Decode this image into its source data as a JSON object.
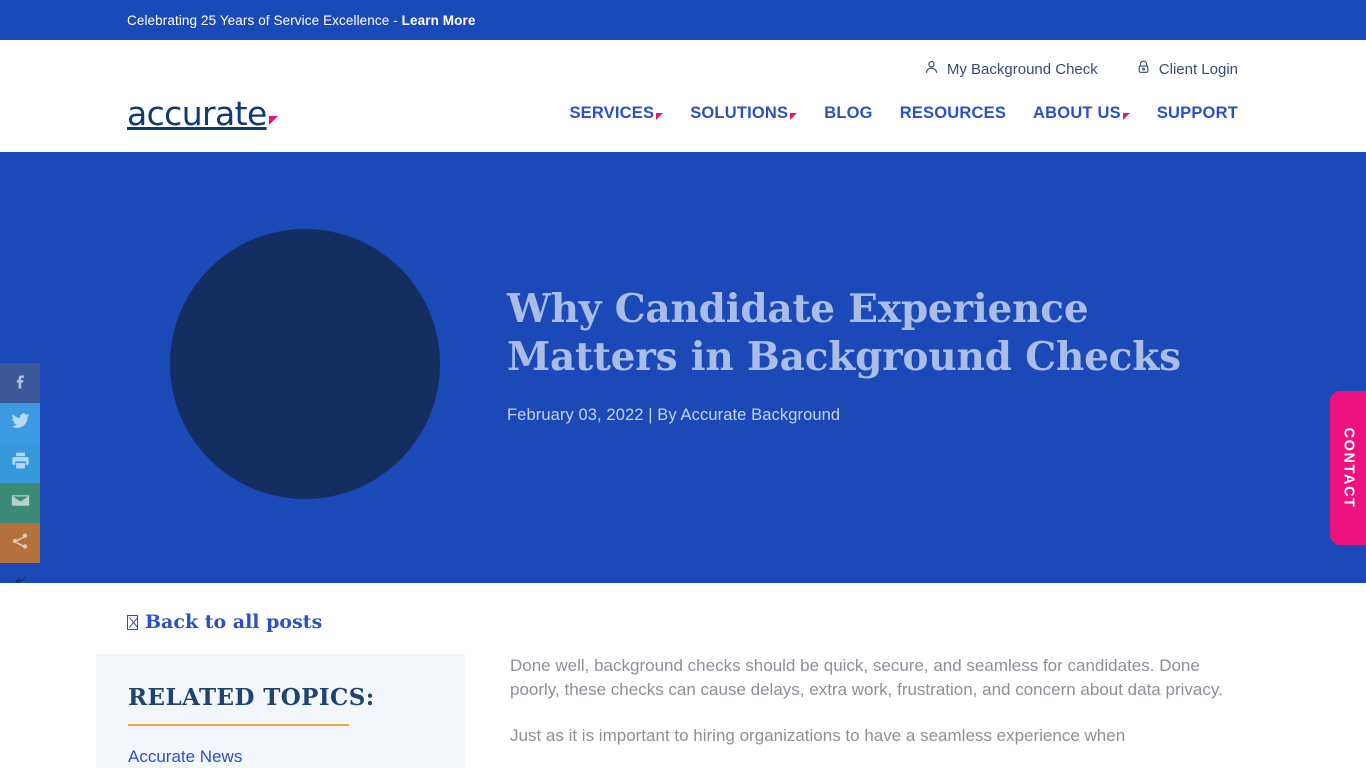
{
  "announcement": {
    "text": "Celebrating 25 Years of Service Excellence - ",
    "link_label": "Learn More"
  },
  "header": {
    "utility_links": [
      {
        "label": "My Background Check",
        "icon": "person-icon"
      },
      {
        "label": "Client Login",
        "icon": "lock-icon"
      }
    ],
    "logo": {
      "wordmark": "accurate",
      "accent_color": "#e8117f"
    },
    "nav": [
      {
        "label": "SERVICES",
        "has_dropdown": true
      },
      {
        "label": "SOLUTIONS",
        "has_dropdown": true
      },
      {
        "label": "BLOG",
        "has_dropdown": false
      },
      {
        "label": "RESOURCES",
        "has_dropdown": false
      },
      {
        "label": "ABOUT US",
        "has_dropdown": true
      },
      {
        "label": "SUPPORT",
        "has_dropdown": false
      }
    ]
  },
  "hero": {
    "title": "Why Candidate Experience Matters in Background Checks",
    "meta": "February 03, 2022 | By Accurate Background",
    "background_color": "#1b4ab8",
    "circle_color": "#152e61"
  },
  "share_rail": {
    "items": [
      {
        "name": "facebook",
        "color": "#3b5998"
      },
      {
        "name": "twitter",
        "color": "#3d9ae0"
      },
      {
        "name": "print",
        "color": "#3498db"
      },
      {
        "name": "email",
        "color": "#3c8a78"
      },
      {
        "name": "share",
        "color": "#b5703f"
      }
    ],
    "hide_label": ""
  },
  "contact_tab": {
    "label": "CONTACT",
    "color": "#ef117f"
  },
  "article": {
    "back_link": "Back to all posts",
    "sidebar": {
      "title": "RELATED TOPICS:",
      "rule_color": "#f0a646",
      "links": [
        "Accurate News"
      ]
    },
    "paragraphs": [
      "Done well, background checks should be quick, secure, and seamless for candidates. Done poorly, these checks can cause delays, extra work, frustration, and concern about data privacy.",
      "Just as it is important to hiring organizations to have a seamless experience when"
    ]
  }
}
